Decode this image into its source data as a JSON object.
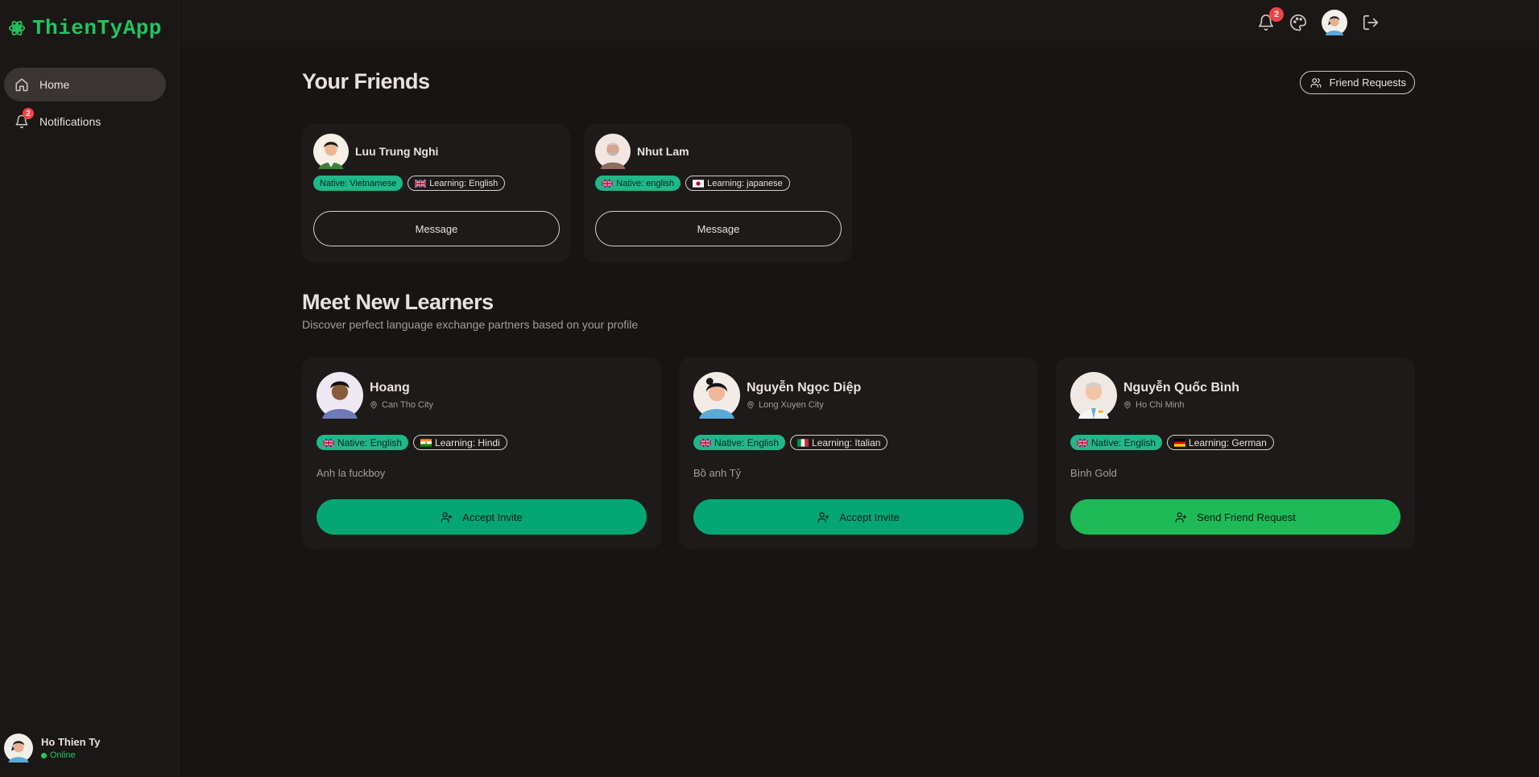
{
  "app": {
    "name": "ThienTyApp"
  },
  "colors": {
    "accent": "#22c55e",
    "native_tag": "#1fb889",
    "accept": "#04a774",
    "send": "#1fba58",
    "badge": "#ef4444"
  },
  "sidebar": {
    "items": [
      {
        "label": "Home",
        "icon": "home-icon",
        "active": true
      },
      {
        "label": "Notifications",
        "icon": "bell-icon",
        "badge": "2"
      }
    ],
    "user": {
      "name": "Ho Thien Ty",
      "status": "Online"
    }
  },
  "topbar": {
    "notification_count": "2",
    "icons": [
      "bell-icon",
      "palette-icon",
      "avatar",
      "logout-icon"
    ]
  },
  "friends": {
    "title": "Your Friends",
    "requests_label": "Friend Requests",
    "list": [
      {
        "name": "Luu Trung Nghi",
        "native": "Native: Vietnamese",
        "learning": "Learning: English",
        "learning_flag": "gb",
        "button": "Message"
      },
      {
        "name": "Nhut Lam",
        "native": "Native: english",
        "native_flag": "gb",
        "learning": "Learning: japanese",
        "learning_flag": "jp",
        "button": "Message"
      }
    ]
  },
  "learners": {
    "title": "Meet New Learners",
    "subtitle": "Discover perfect language exchange partners based on your profile",
    "list": [
      {
        "name": "Hoang",
        "location": "Can Tho City",
        "native": "Native: English",
        "learning": "Learning: Hindi",
        "learning_flag": "in",
        "bio": "Anh la fuckboy",
        "button": "Accept Invite"
      },
      {
        "name": "Nguyễn Ngọc Diệp",
        "location": "Long Xuyen City",
        "native": "Native: English",
        "learning": "Learning: Italian",
        "learning_flag": "it",
        "bio": "Bồ anh Tỷ",
        "button": "Accept Invite"
      },
      {
        "name": "Nguyễn Quốc Bình",
        "location": "Ho Chi Minh",
        "native": "Native: English",
        "learning": "Learning: German",
        "learning_flag": "de",
        "bio": "Bình Gold",
        "button": "Send Friend Request"
      }
    ]
  }
}
